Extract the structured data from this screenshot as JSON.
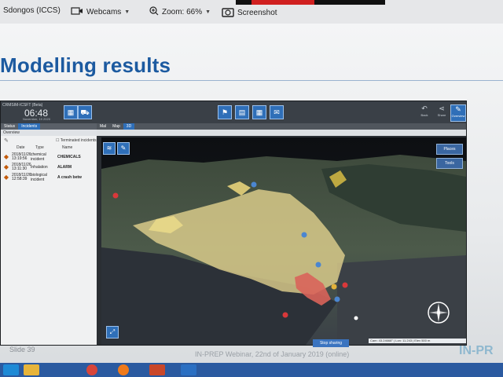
{
  "toolbar": {
    "meeting_name": "Sdongos (ICCS)",
    "webcams_label": "Webcams",
    "zoom_label": "Zoom: 66%",
    "screenshot_label": "Screenshot"
  },
  "slide": {
    "title": "Modelling results",
    "slide_number": "Slide 39",
    "footer_text": "IN-PREP Webinar, 22nd of January 2019 (online)",
    "brand": "IN-PR"
  },
  "app": {
    "name": "CRMSIM-ICSFT (Beta)",
    "time": "06:48",
    "date": "November, 19 2020",
    "header_buttons": [
      "calendar-icon",
      "car-icon",
      "flag-icon",
      "clipboard-icon",
      "grid-icon",
      "mail-icon"
    ],
    "right_buttons": [
      {
        "label": "Back",
        "icon": "back-icon"
      },
      {
        "label": "Share",
        "icon": "share-icon"
      },
      {
        "label": "Overview",
        "icon": "pencil-icon"
      }
    ],
    "incident_tabs": [
      "Status",
      "Incidents"
    ],
    "filter_label": "Overview",
    "terminated_label": "Terminated incidents",
    "columns": [
      "Date",
      "Type",
      "Name"
    ],
    "incidents": [
      {
        "date": "2018/11/26 13:19:56",
        "type": "chemical incident",
        "name": "CHEMICALS"
      },
      {
        "date": "2018/11/26 13:11:30",
        "type": "Inhalation",
        "name": "ALARM"
      },
      {
        "date": "2018/11/26 12:58:39",
        "type": "biological incident",
        "name": "A crash betw"
      }
    ],
    "map_tabs": [
      "Mal",
      "Map",
      "3D"
    ],
    "map_buttons": [
      "layers-icon",
      "pencil-icon"
    ],
    "map_side_buttons": [
      "Places",
      "Tools"
    ],
    "scale_text": "Cam: 43.24668° | Lon: 11.243 | Elev 500 m",
    "stop_label": "Stop sharing"
  },
  "colors": {
    "accent": "#2f6fb8",
    "title": "#1c5aa0",
    "plume": "#e6d58f",
    "hot_zone": "#d9645a"
  }
}
